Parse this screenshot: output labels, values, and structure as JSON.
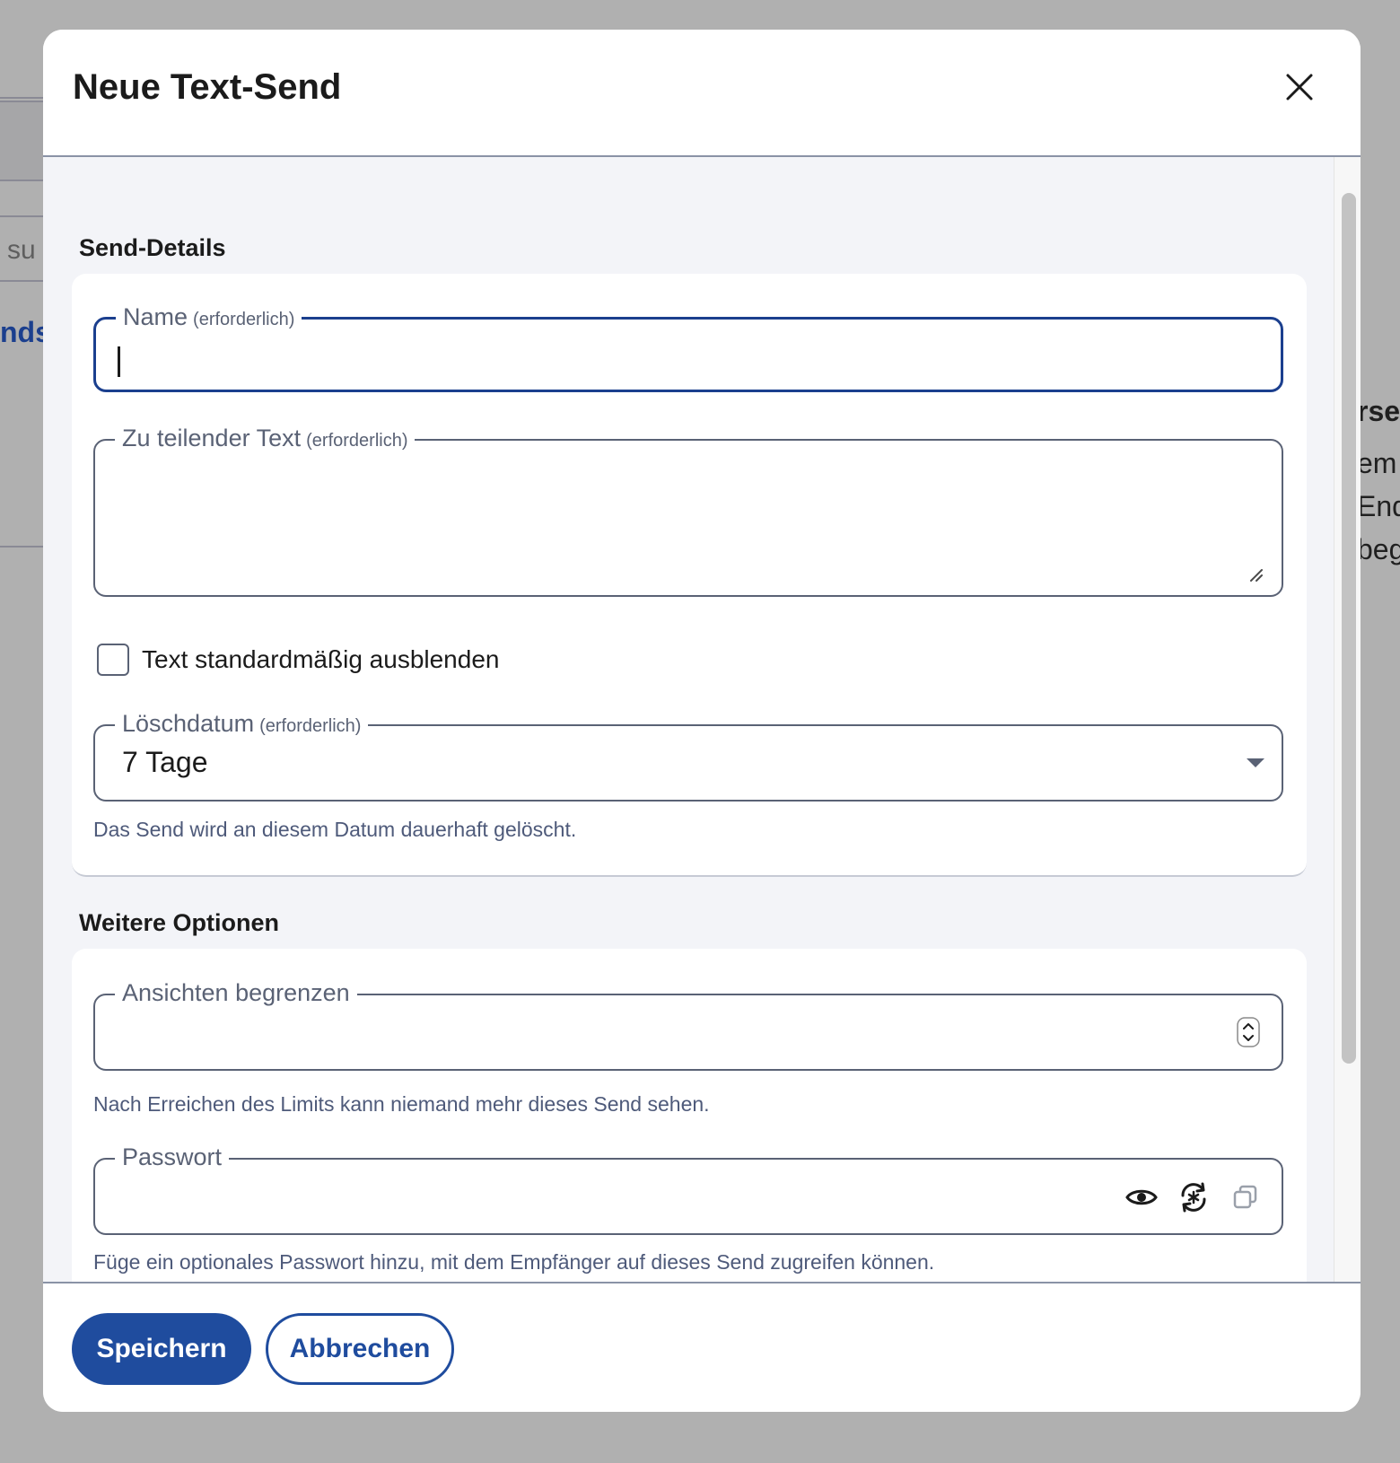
{
  "background": {
    "search_fragment": "su",
    "sends_fragment": "nds",
    "right_fragments": [
      "rse",
      "em",
      "End",
      "beg"
    ]
  },
  "dialog": {
    "title": "Neue Text-Send",
    "close_icon": "close-icon"
  },
  "send_details": {
    "heading": "Send-Details",
    "name_field": {
      "label": "Name",
      "required_text": "(erforderlich)",
      "value": ""
    },
    "text_field": {
      "label": "Zu teilender Text",
      "required_text": "(erforderlich)",
      "value": ""
    },
    "hide_text_checkbox": {
      "label": "Text standardmäßig ausblenden",
      "checked": false
    },
    "deletion_date": {
      "label": "Löschdatum",
      "required_text": "(erforderlich)",
      "selected": "7 Tage",
      "hint": "Das Send wird an diesem Datum dauerhaft gelöscht."
    }
  },
  "more_options": {
    "heading": "Weitere Optionen",
    "limit_views": {
      "label": "Ansichten begrenzen",
      "value": "",
      "hint": "Nach Erreichen des Limits kann niemand mehr dieses Send sehen."
    },
    "password": {
      "label": "Passwort",
      "value": "",
      "hint": "Füge ein optionales Passwort hinzu, mit dem Empfänger auf dieses Send zugreifen können.",
      "icons": [
        "eye-icon",
        "generate-password-icon",
        "copy-icon"
      ]
    }
  },
  "footer": {
    "save_label": "Speichern",
    "cancel_label": "Abbrechen"
  },
  "colors": {
    "primary": "#1f4c9e",
    "focus_border": "#1b3f8e",
    "hint_text": "#4e5a7a"
  }
}
